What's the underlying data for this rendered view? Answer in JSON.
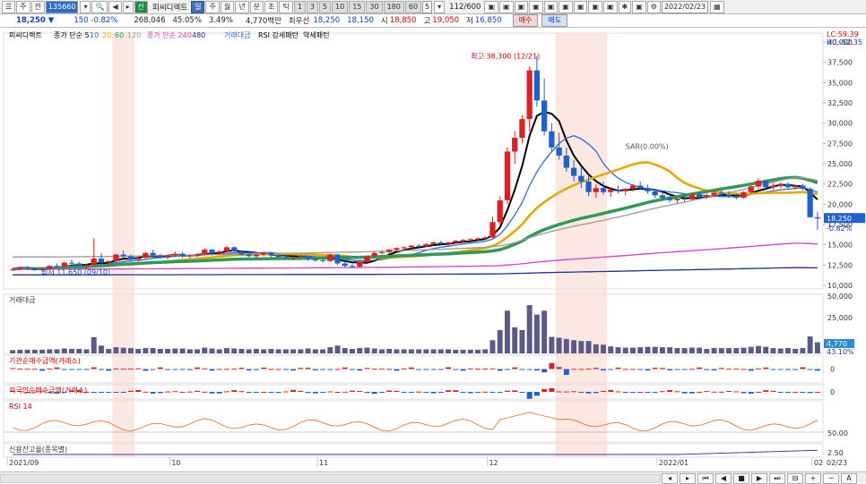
{
  "toolbar1": {
    "items": [
      {
        "id": "list",
        "label": "☰",
        "type": "btn"
      },
      {
        "id": "period",
        "label": "주",
        "type": "btn"
      },
      {
        "id": "all",
        "label": "전",
        "type": "btn"
      },
      {
        "id": "code",
        "label": "135660",
        "type": "field"
      },
      {
        "id": "codedrop",
        "label": "▾",
        "type": "btn"
      },
      {
        "id": "search",
        "label": "🔍",
        "type": "btn"
      },
      {
        "id": "prev",
        "label": "◀",
        "type": "btn"
      },
      {
        "id": "next",
        "label": "▸",
        "type": "btn"
      },
      {
        "id": "shin",
        "label": "신",
        "type": "btn",
        "style": "green"
      },
      {
        "id": "name",
        "label": "피씨디렉트",
        "type": "text"
      },
      {
        "id": "t_il",
        "label": "일",
        "type": "btn",
        "style": "sel"
      },
      {
        "id": "t_ju",
        "label": "주",
        "type": "btn"
      },
      {
        "id": "t_wol",
        "label": "월",
        "type": "btn"
      },
      {
        "id": "t_nyeon",
        "label": "년",
        "type": "btn"
      },
      {
        "id": "t_bun",
        "label": "분",
        "type": "btn"
      },
      {
        "id": "t_cho",
        "label": "초",
        "type": "btn"
      },
      {
        "id": "t_tik",
        "label": "틱",
        "type": "btn"
      },
      {
        "id": "n1",
        "label": "1",
        "type": "btn",
        "style": "gray"
      },
      {
        "id": "n3",
        "label": "3",
        "type": "btn",
        "style": "gray"
      },
      {
        "id": "n5",
        "label": "5",
        "type": "btn",
        "style": "gray"
      },
      {
        "id": "n10",
        "label": "10",
        "type": "btn",
        "style": "gray"
      },
      {
        "id": "n15",
        "label": "15",
        "type": "btn",
        "style": "gray"
      },
      {
        "id": "n30",
        "label": "30",
        "type": "btn",
        "style": "gray"
      },
      {
        "id": "n180",
        "label": "180",
        "type": "btn",
        "style": "gray"
      },
      {
        "id": "n60",
        "label": "60",
        "type": "btn",
        "style": "gray"
      },
      {
        "id": "ncustom",
        "label": "5",
        "type": "field"
      },
      {
        "id": "ncdrop",
        "label": "▾",
        "type": "btn"
      },
      {
        "id": "count",
        "label": "112/600",
        "type": "text"
      },
      {
        "id": "b1",
        "label": "▣",
        "type": "btn"
      },
      {
        "id": "b2",
        "label": "▣",
        "type": "btn"
      },
      {
        "id": "b3",
        "label": "▣",
        "type": "btn"
      },
      {
        "id": "b4",
        "label": "▣",
        "type": "btn"
      },
      {
        "id": "b5",
        "label": "▣",
        "type": "btn"
      },
      {
        "id": "b6",
        "label": "▣",
        "type": "btn"
      },
      {
        "id": "b7",
        "label": "▣",
        "type": "btn"
      },
      {
        "id": "b8",
        "label": "▣",
        "type": "btn"
      },
      {
        "id": "b9",
        "label": "▣",
        "type": "btn"
      },
      {
        "id": "b10",
        "label": "✱",
        "type": "btn"
      },
      {
        "id": "b11",
        "label": "▣",
        "type": "btn"
      },
      {
        "id": "b12",
        "label": "⚙",
        "type": "btn"
      },
      {
        "id": "date",
        "label": "2022/02/23",
        "type": "field"
      },
      {
        "id": "cal",
        "label": "▦",
        "type": "btn"
      }
    ]
  },
  "quote": {
    "price": "18,250",
    "arrow": "▼",
    "change": "150",
    "pct": "-0.82%",
    "volume": "268,046",
    "vol_ratio": "45.05%",
    "turnover": "3.49%",
    "amount": "4,770백만",
    "best_label": "최우선",
    "best_ask": "18,250",
    "best_bid": "18,150",
    "open_label": "시",
    "open": "18,850",
    "high_label": "고",
    "high": "19,050",
    "low_label": "저",
    "low": "16,850",
    "buy_label": "매수",
    "sell_label": "매도"
  },
  "chart_data": {
    "type": "candlestick",
    "dates": [
      "2021/09",
      "10",
      "11",
      "12",
      "2022/01",
      "02",
      "02/23"
    ],
    "ohlc": [
      [
        11900,
        12100,
        11800,
        12000
      ],
      [
        12000,
        12300,
        11900,
        12200
      ],
      [
        12200,
        12400,
        12000,
        12100
      ],
      [
        12100,
        12200,
        11800,
        11900
      ],
      [
        11900,
        12100,
        11700,
        12050
      ],
      [
        12050,
        12500,
        12000,
        12400
      ],
      [
        12400,
        12700,
        12200,
        12300
      ],
      [
        12300,
        12900,
        12200,
        12800
      ],
      [
        12800,
        13200,
        12600,
        12700
      ],
      [
        12700,
        12900,
        12300,
        12400
      ],
      [
        12400,
        12600,
        12100,
        12500
      ],
      [
        12500,
        15800,
        12400,
        13300
      ],
      [
        13300,
        14000,
        12600,
        12800
      ],
      [
        12800,
        13100,
        12500,
        13000
      ],
      [
        13000,
        13900,
        12900,
        13800
      ],
      [
        13800,
        14300,
        13400,
        13600
      ],
      [
        13600,
        13800,
        13000,
        13200
      ],
      [
        13200,
        13500,
        12900,
        13400
      ],
      [
        13400,
        14100,
        13300,
        14000
      ],
      [
        14000,
        14400,
        13600,
        13700
      ],
      [
        13700,
        13900,
        13300,
        13500
      ],
      [
        13500,
        13800,
        13200,
        13700
      ],
      [
        13700,
        14200,
        13500,
        13900
      ],
      [
        13900,
        14100,
        13400,
        13600
      ],
      [
        13600,
        13800,
        13300,
        13700
      ],
      [
        13700,
        14000,
        13500,
        13800
      ],
      [
        13800,
        14600,
        13700,
        14400
      ],
      [
        14400,
        14500,
        13800,
        14000
      ],
      [
        14000,
        14300,
        13800,
        14200
      ],
      [
        14200,
        14900,
        14100,
        14700
      ],
      [
        14700,
        14800,
        14100,
        14200
      ],
      [
        14200,
        14300,
        13700,
        13800
      ],
      [
        13800,
        14000,
        13500,
        13600
      ],
      [
        13600,
        13900,
        13300,
        13800
      ],
      [
        13800,
        14100,
        13600,
        14000
      ],
      [
        14000,
        14100,
        13500,
        13700
      ],
      [
        13700,
        13900,
        13400,
        13500
      ],
      [
        13500,
        13700,
        13200,
        13400
      ],
      [
        13400,
        13600,
        13100,
        13500
      ],
      [
        13500,
        13800,
        13300,
        13600
      ],
      [
        13600,
        13700,
        13000,
        13200
      ],
      [
        13200,
        13400,
        12900,
        13100
      ],
      [
        13100,
        13300,
        12800,
        13000
      ],
      [
        13000,
        13900,
        12900,
        13800
      ],
      [
        13800,
        13900,
        12500,
        12700
      ],
      [
        12700,
        13000,
        12200,
        12400
      ],
      [
        12400,
        12700,
        12100,
        12300
      ],
      [
        12300,
        13000,
        12200,
        12900
      ],
      [
        12900,
        13700,
        12800,
        13600
      ],
      [
        13600,
        14200,
        13500,
        14000
      ],
      [
        14000,
        14300,
        13800,
        14100
      ],
      [
        14100,
        14500,
        13900,
        14400
      ],
      [
        14400,
        14700,
        14200,
        14600
      ],
      [
        14600,
        14800,
        14300,
        14700
      ],
      [
        14700,
        15000,
        14500,
        14900
      ],
      [
        14900,
        15100,
        14600,
        14800
      ],
      [
        14800,
        15200,
        14700,
        15100
      ],
      [
        15100,
        15400,
        14900,
        15300
      ],
      [
        15300,
        15500,
        15000,
        15100
      ],
      [
        15100,
        15400,
        14900,
        15300
      ],
      [
        15300,
        15600,
        15200,
        15500
      ],
      [
        15500,
        15700,
        15300,
        15600
      ],
      [
        15600,
        15800,
        15400,
        15700
      ],
      [
        15700,
        15900,
        15500,
        15800
      ],
      [
        15800,
        16100,
        15600,
        15900
      ],
      [
        15900,
        18500,
        15800,
        17800
      ],
      [
        17800,
        21000,
        17500,
        20500
      ],
      [
        20500,
        27000,
        20000,
        26500
      ],
      [
        26500,
        29000,
        25000,
        28200
      ],
      [
        28200,
        31000,
        27500,
        30500
      ],
      [
        30500,
        37000,
        29000,
        36500
      ],
      [
        36500,
        38300,
        32000,
        32800
      ],
      [
        32800,
        35500,
        28500,
        29000
      ],
      [
        29000,
        30000,
        26500,
        27000
      ],
      [
        27000,
        28800,
        25500,
        26000
      ],
      [
        26000,
        27000,
        24000,
        24500
      ],
      [
        24500,
        25500,
        22800,
        23500
      ],
      [
        23500,
        24500,
        22000,
        22800
      ],
      [
        22800,
        23500,
        21000,
        21500
      ],
      [
        21500,
        22500,
        20800,
        22000
      ],
      [
        22000,
        22800,
        21200,
        21500
      ],
      [
        21500,
        22100,
        20900,
        21800
      ],
      [
        21800,
        22300,
        21300,
        21600
      ],
      [
        21600,
        22000,
        21100,
        21900
      ],
      [
        21900,
        22500,
        21600,
        22300
      ],
      [
        22300,
        22800,
        21800,
        22000
      ],
      [
        22000,
        22400,
        21300,
        21600
      ],
      [
        21600,
        21900,
        20800,
        21100
      ],
      [
        21100,
        21400,
        20400,
        20800
      ],
      [
        20800,
        21200,
        20200,
        20500
      ],
      [
        20500,
        20900,
        20100,
        20700
      ],
      [
        20700,
        21100,
        20300,
        20600
      ],
      [
        20600,
        21400,
        20500,
        21200
      ],
      [
        21200,
        21500,
        20600,
        20900
      ],
      [
        20900,
        21300,
        20700,
        21100
      ],
      [
        21100,
        21700,
        20900,
        21400
      ],
      [
        21400,
        21800,
        21000,
        21200
      ],
      [
        21200,
        21600,
        20800,
        21000
      ],
      [
        21000,
        21400,
        20600,
        20800
      ],
      [
        20800,
        21600,
        20700,
        21500
      ],
      [
        21500,
        22400,
        21300,
        22200
      ],
      [
        22200,
        23200,
        21900,
        22900
      ],
      [
        22900,
        23000,
        21900,
        22100
      ],
      [
        22100,
        22600,
        21800,
        22300
      ],
      [
        22300,
        22700,
        22000,
        22500
      ],
      [
        22500,
        22700,
        21900,
        22100
      ],
      [
        22100,
        22400,
        21800,
        22300
      ],
      [
        22300,
        22500,
        21700,
        21900
      ],
      [
        21900,
        22100,
        18500,
        18400
      ],
      [
        18400,
        19050,
        16850,
        18250
      ]
    ],
    "price_axis": {
      "min": 10000,
      "max": 40000,
      "ticks": [
        "40,000",
        "37,500",
        "35,000",
        "32,500",
        "30,000",
        "27,500",
        "25,000",
        "22,500",
        "20,000",
        "17,500",
        "15,000",
        "12,500",
        "10,000"
      ]
    },
    "current_price_label": "18,250",
    "current_pct_label": "-0.82%",
    "lc_label": "LC:59.39",
    "hc_label": "HC:-52.35",
    "high_annotation": "최고 38,300 (12/21)",
    "low_annotation": "최저 11,650 (09/10)",
    "sar_label": "SAR(0.00%)",
    "ma": [
      {
        "name": "5",
        "color": "#000000",
        "period": 5
      },
      {
        "name": "10",
        "color": "#2b6cd8",
        "period": 10
      },
      {
        "name": "20",
        "color": "#e8a800",
        "period": 20
      },
      {
        "name": "60",
        "color": "#2e9a55",
        "period": 60
      },
      {
        "name": "120",
        "color": "#999999",
        "period": 120
      },
      {
        "name": "240",
        "color": "#d040c0",
        "period": 240
      },
      {
        "name": "480",
        "color": "#203090",
        "period": 480
      }
    ],
    "volume_ticks": [
      "50,000",
      "25,000"
    ],
    "volume_label": "4,770",
    "volume_pct": "43.10%",
    "inst_tick": "0",
    "foreign_tick": "0",
    "rsi_tick": "50.00",
    "credit_tick": "2.50"
  },
  "legend": {
    "title": "피씨디렉트",
    "ma_prefix": "종가 단순 5",
    "ma_10": "10",
    "ma_20": "20",
    "ma_60": "60",
    "ma_120": "120",
    "ma2_prefix": "종가 단순 240",
    "ma_480": "480",
    "vol_amt": "거래대금",
    "rsi_pattern": "RSI 강세패턴",
    "weak_pattern": "약세패턴"
  },
  "panels": {
    "volume": "거래대금",
    "inst": "기관순매수금액(거래소)",
    "foreign": "외국인순매수금액(거래소)",
    "rsi": "RSI 14",
    "credit": "신용잔고율(종목별)"
  },
  "xaxis": {
    "labels": [
      "2021/09",
      "10",
      "11",
      "12",
      "2022/01",
      "02",
      "02/23"
    ]
  }
}
